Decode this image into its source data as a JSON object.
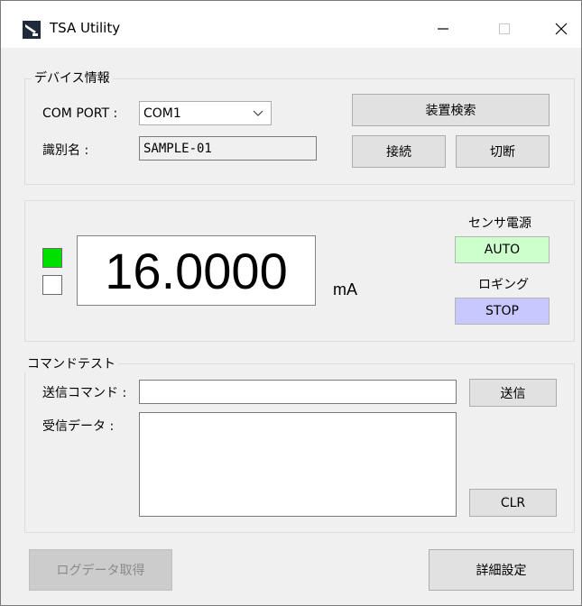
{
  "window": {
    "title": "TSA Utility"
  },
  "device_info": {
    "legend": "デバイス情報",
    "com_port_label": "COM PORT :",
    "com_port_value": "COM1",
    "id_label": "識別名 :",
    "id_value": "SAMPLE-01",
    "search_button": "装置検索",
    "connect_button": "接続",
    "disconnect_button": "切断"
  },
  "measurement": {
    "value": "16.0000",
    "unit": "mA",
    "sensor_power_label": "センサ電源",
    "sensor_power_status": "AUTO",
    "logging_label": "ロギング",
    "logging_status": "STOP",
    "colors": {
      "indicator_on": "#00e000",
      "auto_bg": "#ccffcc",
      "stop_bg": "#c8c8ff"
    }
  },
  "command_test": {
    "legend": "コマンドテスト",
    "send_label": "送信コマンド :",
    "send_value": "",
    "send_button": "送信",
    "receive_label": "受信データ :",
    "receive_value": "",
    "clear_button": "CLR"
  },
  "footer": {
    "log_button": "ログデータ取得",
    "settings_button": "詳細設定"
  }
}
